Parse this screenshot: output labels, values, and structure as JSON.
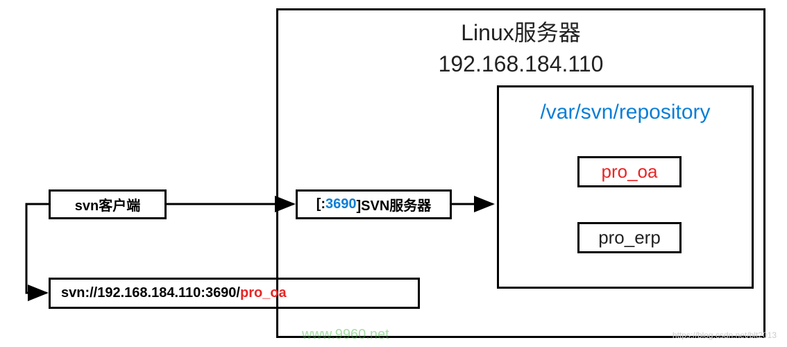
{
  "client": {
    "label": "svn客户端"
  },
  "server": {
    "title_line1": "Linux服务器",
    "title_line2": "192.168.184.110",
    "svn_service": {
      "prefix": "[:",
      "port": "3690",
      "suffix": "]SVN服务器"
    }
  },
  "repository": {
    "path": "/var/svn/repository",
    "items": [
      {
        "name": "pro_oa",
        "highlighted": true
      },
      {
        "name": "pro_erp",
        "highlighted": false
      }
    ]
  },
  "svn_url": {
    "base": "svn://192.168.184.110:3690/",
    "repo": "pro_oa"
  },
  "watermark": {
    "green": "www.9960.net",
    "gray": "https://blog.csdn.net/blt2013"
  }
}
